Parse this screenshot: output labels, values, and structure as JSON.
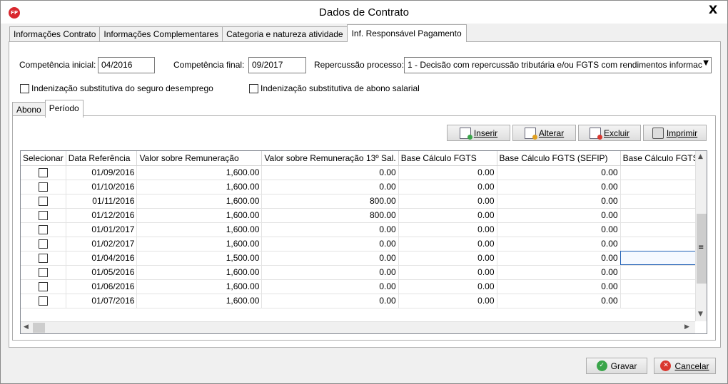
{
  "window": {
    "title": "Dados de Contrato",
    "app_icon_text": "FP",
    "close_label": "X"
  },
  "main_tabs": [
    {
      "label": "Informações Contrato"
    },
    {
      "label": "Informações Complementares"
    },
    {
      "label": "Categoria e natureza atividade"
    },
    {
      "label": "Inf. Responsável Pagamento"
    }
  ],
  "form": {
    "competencia_inicial_label": "Competência inicial:",
    "competencia_inicial_value": "04/2016",
    "competencia_final_label": "Competência final:",
    "competencia_final_value": "09/2017",
    "repercussao_label": "Repercussão processo:",
    "repercussao_value": "1 - Decisão com repercussão tributária e/ou FGTS com rendimentos informac",
    "checkbox_seguro_label": "Indenização substitutiva do seguro desemprego",
    "checkbox_abono_label": "Indenização substitutiva de abono salarial"
  },
  "inner_tabs": [
    {
      "label": "Abono"
    },
    {
      "label": "Período"
    }
  ],
  "toolbar": {
    "inserir": "Inserir",
    "alterar": "Alterar",
    "excluir": "Excluir",
    "imprimir": "Imprimir"
  },
  "grid": {
    "columns": [
      "Selecionar",
      "Data Referência",
      "Valor sobre Remuneração",
      "Valor sobre Remuneração 13º Sal.",
      "Base Cálculo FGTS",
      "Base Cálculo FGTS (SEFIP)",
      "Base Cálculo FGTS ("
    ],
    "rows": [
      {
        "date": "01/09/2016",
        "rem": "1,600.00",
        "rem13": "0.00",
        "fgts": "0.00",
        "sefip": "0.00"
      },
      {
        "date": "01/10/2016",
        "rem": "1,600.00",
        "rem13": "0.00",
        "fgts": "0.00",
        "sefip": "0.00"
      },
      {
        "date": "01/11/2016",
        "rem": "1,600.00",
        "rem13": "800.00",
        "fgts": "0.00",
        "sefip": "0.00"
      },
      {
        "date": "01/12/2016",
        "rem": "1,600.00",
        "rem13": "800.00",
        "fgts": "0.00",
        "sefip": "0.00"
      },
      {
        "date": "01/01/2017",
        "rem": "1,600.00",
        "rem13": "0.00",
        "fgts": "0.00",
        "sefip": "0.00"
      },
      {
        "date": "01/02/2017",
        "rem": "1,600.00",
        "rem13": "0.00",
        "fgts": "0.00",
        "sefip": "0.00"
      },
      {
        "date": "01/04/2016",
        "rem": "1,500.00",
        "rem13": "0.00",
        "fgts": "0.00",
        "sefip": "0.00"
      },
      {
        "date": "01/05/2016",
        "rem": "1,600.00",
        "rem13": "0.00",
        "fgts": "0.00",
        "sefip": "0.00"
      },
      {
        "date": "01/06/2016",
        "rem": "1,600.00",
        "rem13": "0.00",
        "fgts": "0.00",
        "sefip": "0.00"
      },
      {
        "date": "01/07/2016",
        "rem": "1,600.00",
        "rem13": "0.00",
        "fgts": "0.00",
        "sefip": "0.00"
      }
    ]
  },
  "footer": {
    "gravar": "Gravar",
    "cancelar": "Cancelar"
  },
  "colors": {
    "accent": "#1e5fb4",
    "gravar_icon": "#3aa54a",
    "cancelar_icon": "#d9382f"
  }
}
